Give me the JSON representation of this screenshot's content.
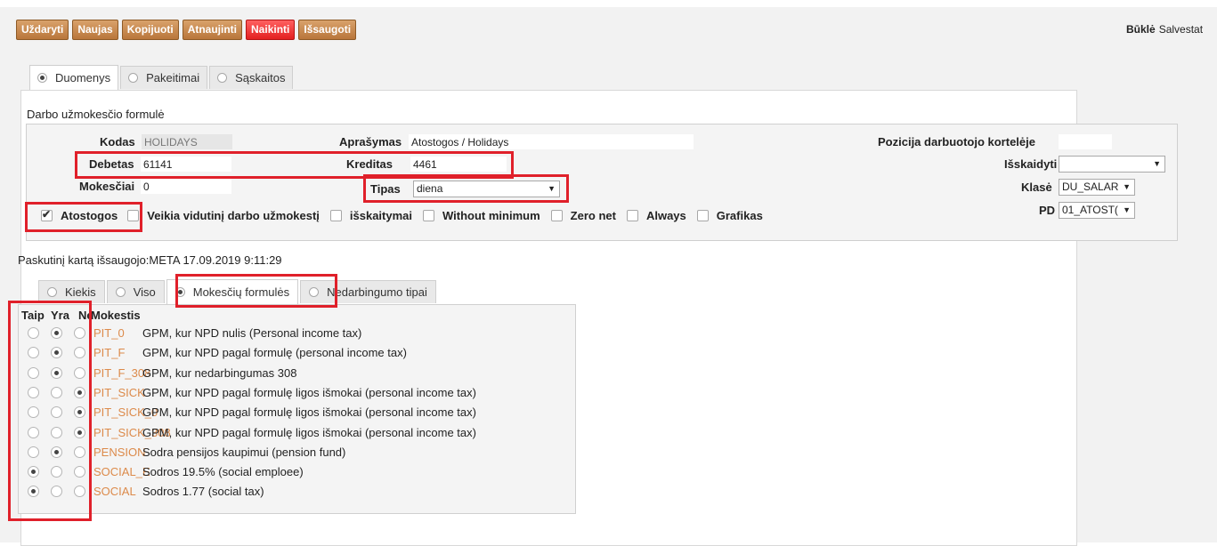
{
  "toolbar": {
    "buttons": [
      {
        "label": "Uždaryti",
        "style": "normal"
      },
      {
        "label": "Naujas",
        "style": "normal"
      },
      {
        "label": "Kopijuoti",
        "style": "normal"
      },
      {
        "label": "Atnaujinti",
        "style": "normal"
      },
      {
        "label": "Naikinti",
        "style": "danger"
      },
      {
        "label": "Išsaugoti",
        "style": "normal"
      }
    ]
  },
  "status": {
    "label": "Būklė",
    "value": "Salvestat"
  },
  "main_tabs": [
    {
      "label": "Duomenys",
      "active": true
    },
    {
      "label": "Pakeitimai",
      "active": false
    },
    {
      "label": "Sąskaitos",
      "active": false
    }
  ],
  "section_title": "Darbo užmokesčio formulė",
  "form": {
    "kodas": {
      "label": "Kodas",
      "value": "HOLIDAYS"
    },
    "aprasymas": {
      "label": "Aprašymas",
      "value": "Atostogos / Holidays"
    },
    "pozicija": {
      "label": "Pozicija darbuotojo kortelėje",
      "value": ""
    },
    "debetas": {
      "label": "Debetas",
      "value": "61141"
    },
    "kreditas": {
      "label": "Kreditas",
      "value": "4461"
    },
    "isskaidyti": {
      "label": "Išskaidyti",
      "value": ""
    },
    "mokesciai": {
      "label": "Mokesčiai",
      "value": "0"
    },
    "tipas": {
      "label": "Tipas",
      "value": "diena"
    },
    "klase": {
      "label": "Klasė",
      "value": "DU_SALAR"
    },
    "pd": {
      "label": "PD",
      "value": "01_ATOST("
    }
  },
  "checkboxes": [
    {
      "label": "Atostogos",
      "checked": true
    },
    {
      "label": "Veikia vidutinį darbo užmokestį",
      "checked": false
    },
    {
      "label": "išskaitymai",
      "checked": false
    },
    {
      "label": "Without minimum",
      "checked": false
    },
    {
      "label": "Zero net",
      "checked": false
    },
    {
      "label": "Always",
      "checked": false
    },
    {
      "label": "Grafikas",
      "checked": false
    }
  ],
  "last_saved": "Paskutinį kartą išsaugojo:META 17.09.2019 9:11:29",
  "sub_tabs": [
    {
      "label": "Kiekis",
      "active": false
    },
    {
      "label": "Viso",
      "active": false
    },
    {
      "label": "Mokesčių formulės",
      "active": true
    },
    {
      "label": "Nedarbingumo tipai",
      "active": false
    }
  ],
  "tax_table": {
    "headers": [
      "Taip",
      "Yra",
      "Ne",
      "Mokestis"
    ],
    "rows": [
      {
        "code": "PIT_0",
        "description": "GPM, kur NPD nulis (Personal income tax)",
        "selected": "Yra"
      },
      {
        "code": "PIT_F",
        "description": "GPM, kur NPD pagal formulę (personal income tax)",
        "selected": "Yra"
      },
      {
        "code": "PIT_F_308",
        "description": "GPM, kur nedarbingumas 308",
        "selected": "Yra"
      },
      {
        "code": "PIT_SICK",
        "description": "GPM, kur NPD pagal formulę ligos išmokai (personal income tax)",
        "selected": "Ne"
      },
      {
        "code": "PIT_SICK_0",
        "description": "GPM, kur NPD pagal formulę ligos išmokai (personal income tax)",
        "selected": "Ne"
      },
      {
        "code": "PIT_SICK_308",
        "description": "GPM, kur NPD pagal formulę ligos išmokai (personal income tax)",
        "selected": "Ne"
      },
      {
        "code": "PENSION",
        "description": "Sodra pensijos kaupimui (pension fund)",
        "selected": "Yra"
      },
      {
        "code": "SOCIAL_E",
        "description": "Sodros 19.5% (social emploee)",
        "selected": "Taip"
      },
      {
        "code": "SOCIAL",
        "description": "Sodros 1.77 (social tax)",
        "selected": "Taip"
      }
    ]
  },
  "colors": {
    "accent_button": "#c98a4f",
    "danger_button": "#f03a3a",
    "code_link": "#dc8a4a",
    "highlight_box": "#e0202a"
  }
}
